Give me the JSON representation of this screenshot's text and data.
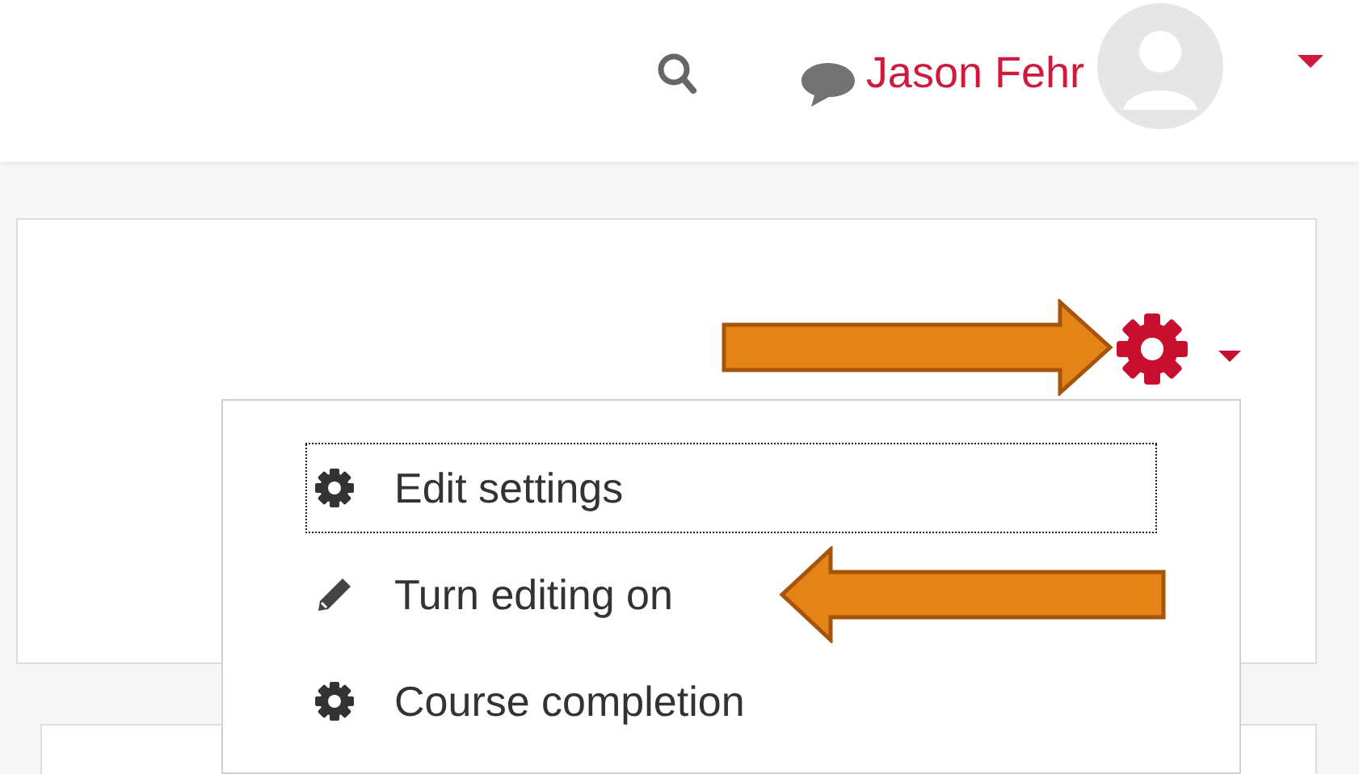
{
  "navbar": {
    "user_name": "Jason Fehr"
  },
  "settings_menu": {
    "items": [
      {
        "label": "Edit settings",
        "kind": "gear",
        "focused": true
      },
      {
        "label": "Turn editing on",
        "kind": "pencil",
        "focused": false
      },
      {
        "label": "Course completion",
        "kind": "gear",
        "focused": false
      }
    ]
  }
}
